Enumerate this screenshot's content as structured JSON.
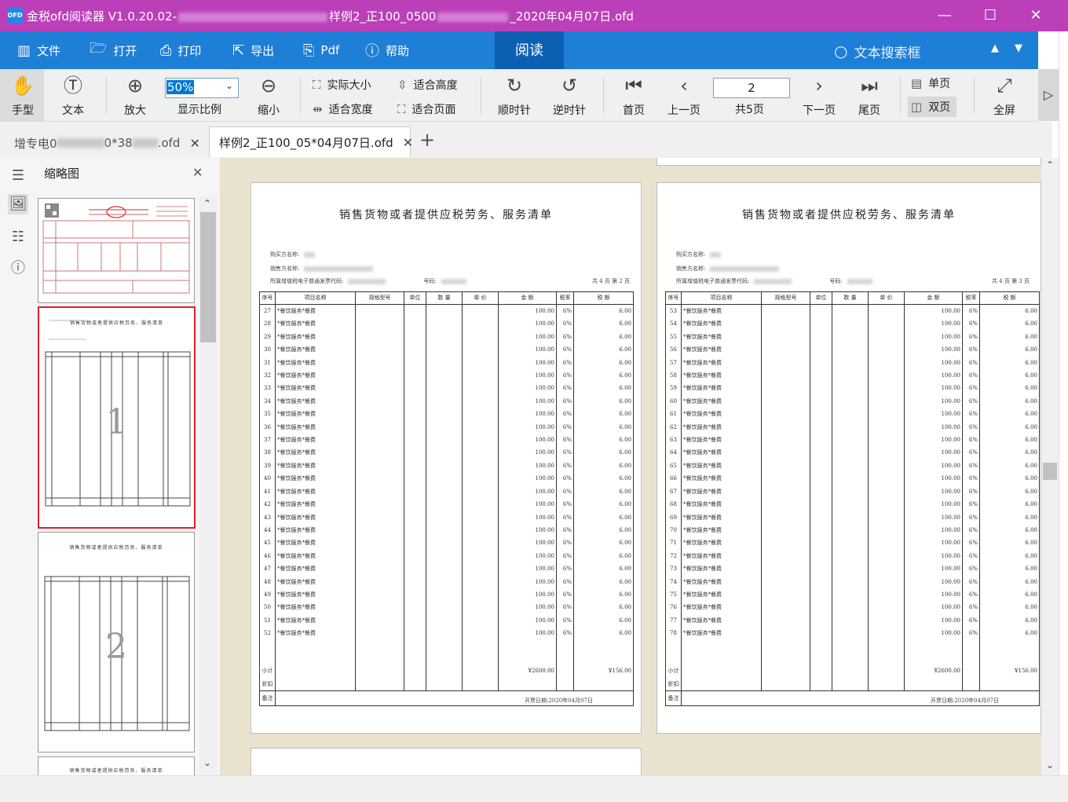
{
  "window": {
    "title_prefix": "金税ofd阅读器 V1.0.20.02-",
    "title_mid": "样例2_正100_0500",
    "title_suffix": "_2020年04月07日.ofd",
    "minimize": "—",
    "maximize": "☐",
    "close": "✕"
  },
  "menu": {
    "file": "文件",
    "open": "打开",
    "print": "打印",
    "export": "导出",
    "pdf": "Pdf",
    "help": "帮助",
    "read_tab": "阅读",
    "search_placeholder": "文本搜索框",
    "prev_arrow": "▲",
    "next_arrow": "▼"
  },
  "toolbar": {
    "hand": "手型",
    "text": "文本",
    "zoom_in": "放大",
    "zoom_value": "50%",
    "zoom_label": "显示比例",
    "zoom_out": "缩小",
    "actual_size": "实际大小",
    "fit_width": "适合宽度",
    "fit_height": "适合高度",
    "fit_page": "适合页面",
    "rotate_cw": "顺时针",
    "rotate_ccw": "逆时针",
    "first_page": "首页",
    "prev_page": "上一页",
    "current_page": "2",
    "total_pages": "共5页",
    "next_page": "下一页",
    "last_page": "尾页",
    "single_page": "单页",
    "double_page": "双页",
    "fullscreen": "全屏",
    "more": "▷"
  },
  "tabs": [
    {
      "label_a": "增专电0",
      "label_b": "0*38",
      "label_c": ".ofd",
      "close": "✕"
    },
    {
      "label": "样例2_正100_05*04月07日.ofd",
      "close": "✕"
    }
  ],
  "new_tab": "+",
  "thumbnails": {
    "title": "缩略图",
    "close": "✕",
    "pages": [
      {
        "num": "1"
      },
      {
        "num": "2"
      }
    ],
    "page_title": "销售货物或者提供应税劳务、服务清单"
  },
  "document": {
    "title": "销售货物或者提供应税劳务、服务清单",
    "buyer_label": "购买方名称:",
    "seller_label": "销售方名称:",
    "invoice_code_label": "所属增值税电子普通发票代码:",
    "number_label": "号码:",
    "columns": [
      "序号",
      "项目名称",
      "规格型号",
      "单位",
      "数 量",
      "单 价",
      "金 额",
      "税率",
      "税 额"
    ],
    "item_name": "*餐饮服务*餐费",
    "amount": "100.00",
    "tax_rate": "6%",
    "tax": "6.00",
    "subtotal_label": "小计",
    "total_label": "折扣",
    "note_label": "备注",
    "subtotal_amount": "¥2600.00",
    "subtotal_tax": "¥156.00",
    "date_text": "开票日期:2020年04月07日",
    "left_page": {
      "count": "共 4 页 第 2 页",
      "rows": [
        "27",
        "28",
        "29",
        "30",
        "31",
        "32",
        "33",
        "34",
        "35",
        "36",
        "37",
        "38",
        "39",
        "40",
        "41",
        "42",
        "43",
        "44",
        "45",
        "46",
        "47",
        "48",
        "49",
        "50",
        "51",
        "52"
      ]
    },
    "right_page": {
      "count": "共 4 页 第 3 页",
      "rows": [
        "53",
        "54",
        "55",
        "56",
        "57",
        "58",
        "59",
        "60",
        "61",
        "62",
        "63",
        "64",
        "65",
        "66",
        "67",
        "68",
        "69",
        "70",
        "71",
        "72",
        "73",
        "74",
        "75",
        "76",
        "77",
        "78"
      ]
    }
  }
}
